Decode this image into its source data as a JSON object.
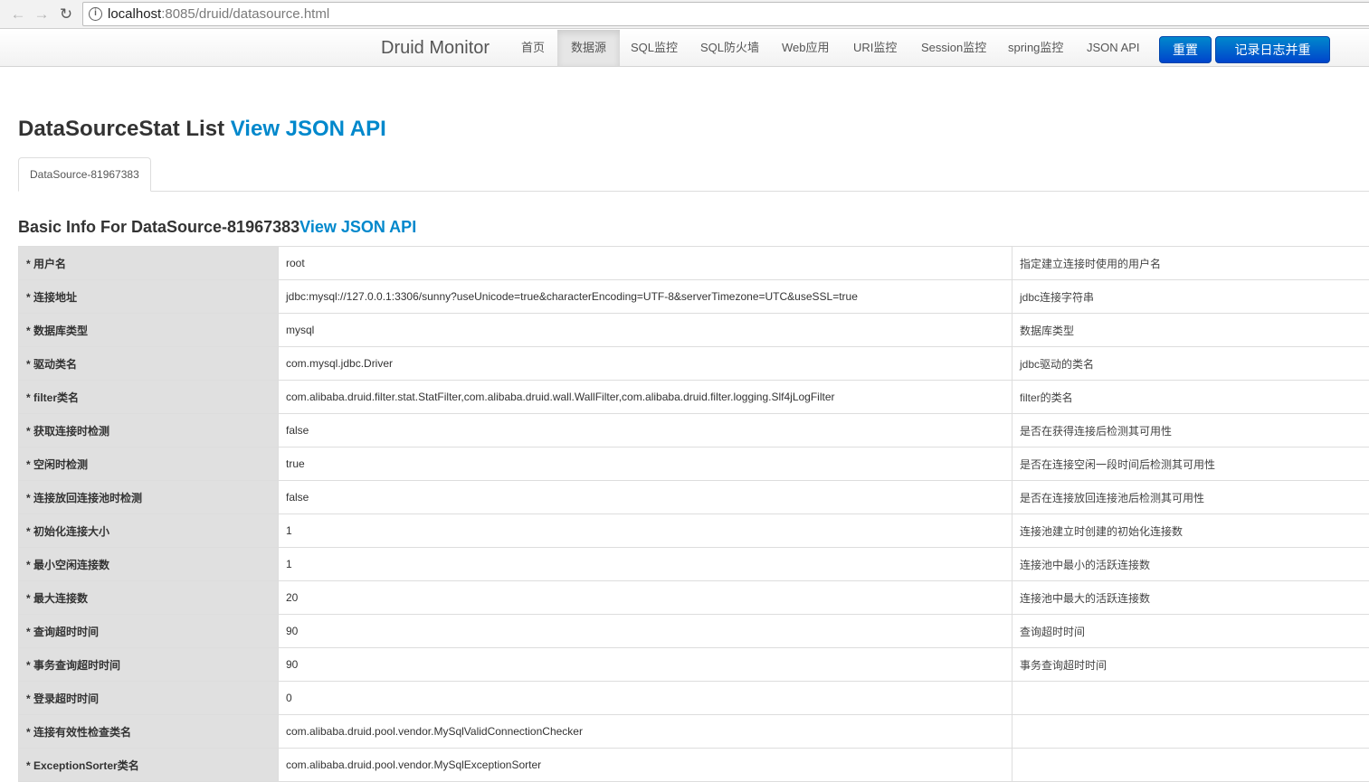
{
  "browser": {
    "url_host": "localhost",
    "url_path": ":8085/druid/datasource.html"
  },
  "navbar": {
    "brand": "Druid Monitor",
    "items": [
      {
        "label": "首页"
      },
      {
        "label": "数据源"
      },
      {
        "label": "SQL监控"
      },
      {
        "label": "SQL防火墙"
      },
      {
        "label": "Web应用"
      },
      {
        "label": "URI监控"
      },
      {
        "label": "Session监控"
      },
      {
        "label": "spring监控"
      },
      {
        "label": "JSON API"
      }
    ],
    "active_item": "数据源",
    "reset_label": "重置",
    "log_reset_label": "记录日志并重置"
  },
  "page": {
    "title": "DataSourceStat List ",
    "title_link": "View JSON API",
    "tab_label": "DataSource-81967383",
    "section_title": "Basic Info For DataSource-81967383",
    "section_link": "View JSON API"
  },
  "rows": [
    {
      "key": "* 用户名",
      "value": "root",
      "desc": "指定建立连接时使用的用户名"
    },
    {
      "key": "* 连接地址",
      "value": "jdbc:mysql://127.0.0.1:3306/sunny?useUnicode=true&characterEncoding=UTF-8&serverTimezone=UTC&useSSL=true",
      "desc": "jdbc连接字符串"
    },
    {
      "key": "* 数据库类型",
      "value": "mysql",
      "desc": "数据库类型"
    },
    {
      "key": "* 驱动类名",
      "value": "com.mysql.jdbc.Driver",
      "desc": "jdbc驱动的类名"
    },
    {
      "key": "* filter类名",
      "value": "com.alibaba.druid.filter.stat.StatFilter,com.alibaba.druid.wall.WallFilter,com.alibaba.druid.filter.logging.Slf4jLogFilter",
      "desc": "filter的类名"
    },
    {
      "key": "* 获取连接时检测",
      "value": "false",
      "desc": "是否在获得连接后检测其可用性"
    },
    {
      "key": "* 空闲时检测",
      "value": "true",
      "desc": "是否在连接空闲一段时间后检测其可用性"
    },
    {
      "key": "* 连接放回连接池时检测",
      "value": "false",
      "desc": "是否在连接放回连接池后检测其可用性"
    },
    {
      "key": "* 初始化连接大小",
      "value": "1",
      "desc": "连接池建立时创建的初始化连接数"
    },
    {
      "key": "* 最小空闲连接数",
      "value": "1",
      "desc": "连接池中最小的活跃连接数"
    },
    {
      "key": "* 最大连接数",
      "value": "20",
      "desc": "连接池中最大的活跃连接数"
    },
    {
      "key": "* 查询超时时间",
      "value": "90",
      "desc": "查询超时时间"
    },
    {
      "key": "* 事务查询超时时间",
      "value": "90",
      "desc": "事务查询超时时间"
    },
    {
      "key": "* 登录超时时间",
      "value": "0",
      "desc": ""
    },
    {
      "key": "* 连接有效性检查类名",
      "value": "com.alibaba.druid.pool.vendor.MySqlValidConnectionChecker",
      "desc": ""
    },
    {
      "key": "* ExceptionSorter类名",
      "value": "com.alibaba.druid.pool.vendor.MySqlExceptionSorter",
      "desc": ""
    }
  ]
}
